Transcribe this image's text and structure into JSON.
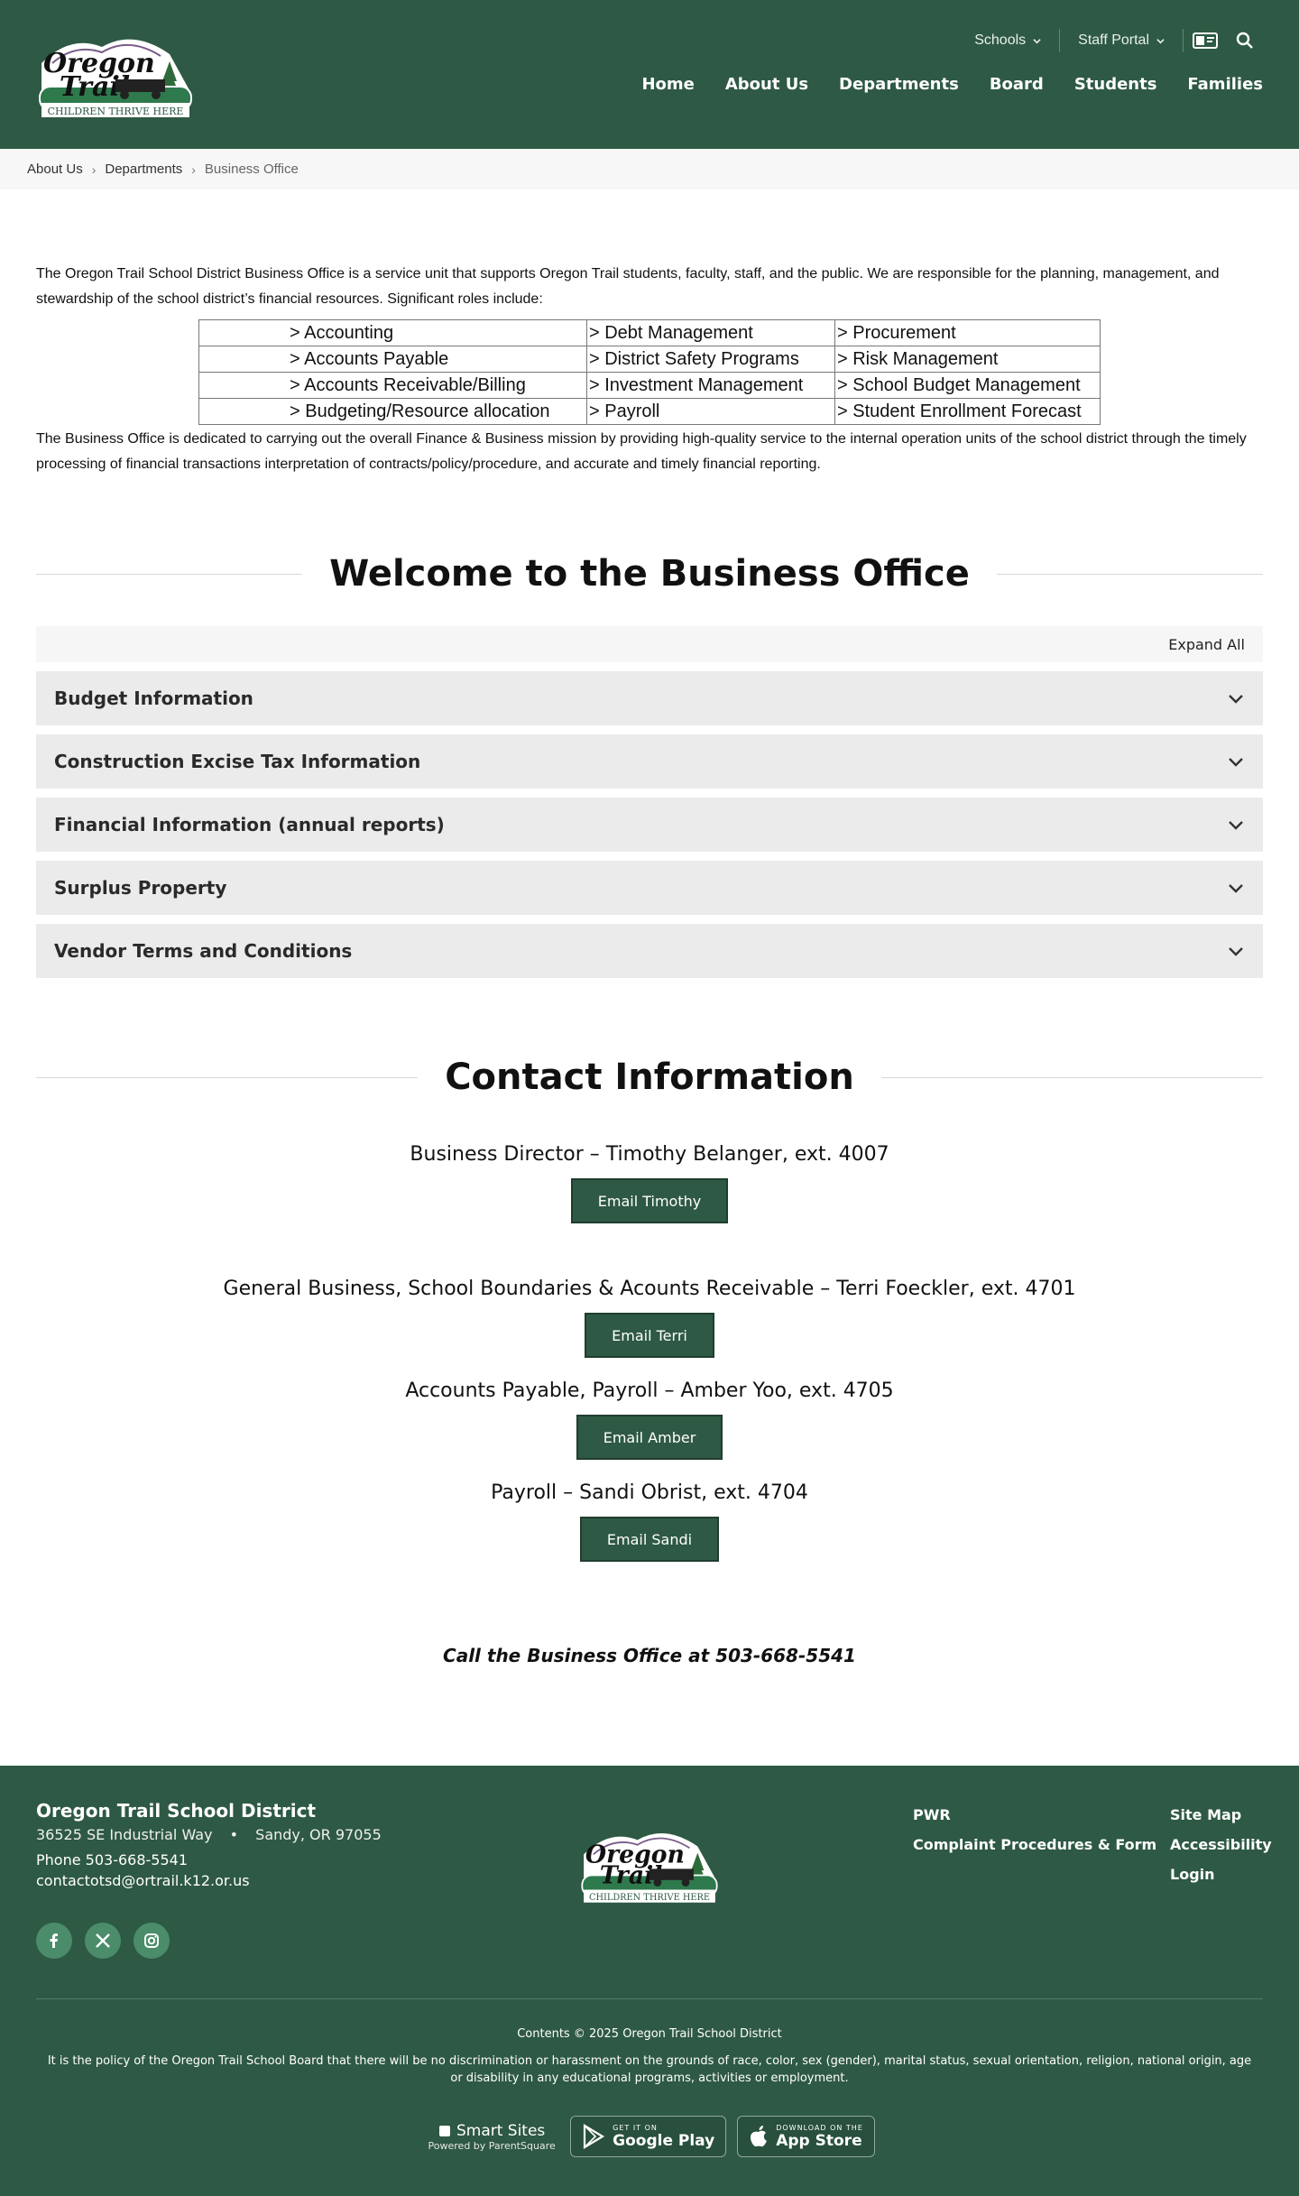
{
  "header": {
    "logo_line1": "Oregon",
    "logo_line2": "Trail",
    "logo_tagline": "CHILDREN THRIVE HERE",
    "utility": {
      "schools": "Schools",
      "staff_portal": "Staff Portal"
    },
    "nav": [
      "Home",
      "About Us",
      "Departments",
      "Board",
      "Students",
      "Families"
    ]
  },
  "breadcrumb": {
    "items": [
      "About Us",
      "Departments"
    ],
    "current": "Business Office"
  },
  "intro": {
    "paragraph": "The Oregon Trail School District Business Office is a service unit that supports Oregon Trail students, faculty, staff, and the public. We are responsible for the planning, management, and stewardship of the school district’s financial resources. Significant roles include:",
    "roles": [
      [
        "> Accounting",
        "> Debt Management",
        "> Procurement"
      ],
      [
        "> Accounts Payable",
        "> District Safety Programs",
        "> Risk Management"
      ],
      [
        "> Accounts Receivable/Billing",
        "> Investment Management",
        "> School Budget Management"
      ],
      [
        "> Budgeting/Resource allocation",
        "> Payroll",
        "> Student Enrollment Forecast"
      ]
    ],
    "mission": "The Business Office is dedicated to carrying out the overall Finance & Business mission by providing high-quality service to the internal operation units of the school district through the timely processing of financial transactions interpretation of contracts/policy/procedure, and accurate and timely financial reporting."
  },
  "welcome": {
    "heading": "Welcome to the Business Office",
    "expand_all": "Expand All",
    "accordion": [
      "Budget Information",
      "Construction Excise Tax Information",
      "Financial Information (annual reports)",
      "Surplus Property",
      "Vendor Terms and Conditions"
    ]
  },
  "contact": {
    "heading": "Contact Information",
    "entries": [
      {
        "line": "Business Director – Timothy Belanger, ext. 4007",
        "button": "Email Timothy"
      },
      {
        "line": "General Business, School Boundaries & Acounts Receivable – Terri Foeckler, ext. 4701",
        "button": "Email Terri"
      },
      {
        "line": "Accounts Payable, Payroll – Amber Yoo, ext. 4705",
        "button": "Email Amber"
      },
      {
        "line": "Payroll – Sandi Obrist, ext. 4704",
        "button": "Email Sandi"
      }
    ],
    "callout": "Call the Business Office at 503-668-5541"
  },
  "footer": {
    "district": "Oregon Trail School District",
    "address": "36525 SE Industrial Way",
    "city": "Sandy, OR 97055",
    "phone": "Phone 503-668-5541",
    "email": "contactotsd@ortrail.k12.or.us",
    "links_col1": [
      "PWR",
      "Complaint Procedures & Form"
    ],
    "links_col2": [
      "Site Map",
      "Accessibility",
      "Login"
    ],
    "copyright": "Contents © 2025 Oregon Trail School District",
    "policy": "It is the policy of the Oregon Trail School Board that there will be no discrimination or harassment on the grounds of race, color, sex (gender), marital status, sexual orientation, religion, national origin, age or disability in any educational programs, activities or employment.",
    "smartsites": "Smart Sites",
    "powered": "Powered by ParentSquare",
    "google_small": "GET IT ON",
    "google_big": "Google Play",
    "apple_small": "DOWNLOAD ON THE",
    "apple_big": "App Store"
  },
  "colors": {
    "brand_green": "#2e5944",
    "accent_green": "#4b8c6a",
    "accordion_bg": "#ebebeb"
  }
}
